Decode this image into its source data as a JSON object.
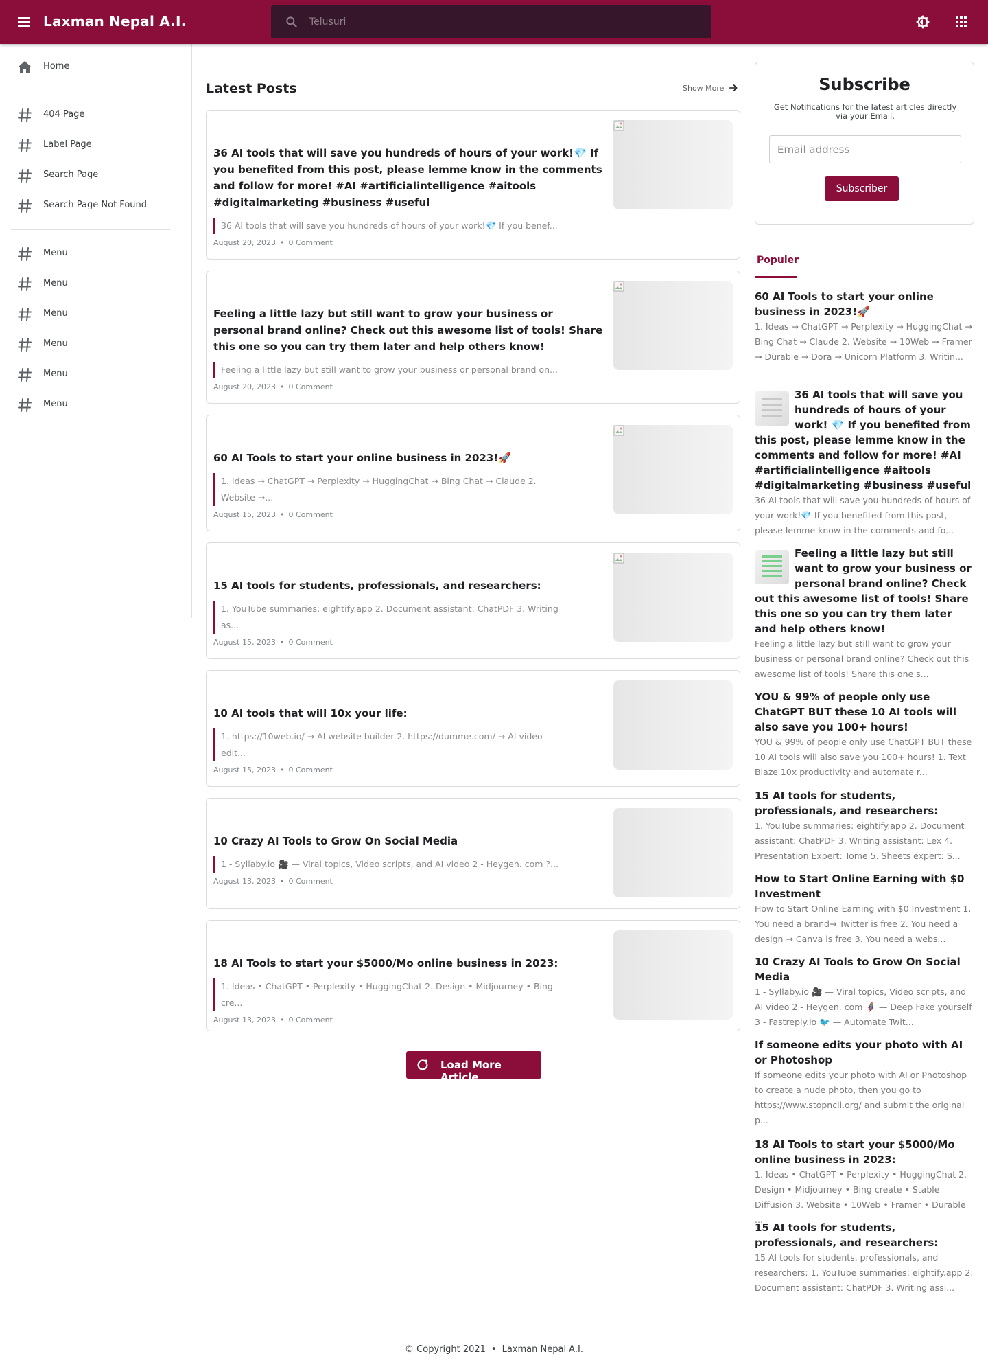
{
  "header": {
    "site_title": "Laxman Nepal A.I.",
    "search_placeholder": "Telusuri",
    "icons": [
      "menu-icon",
      "search-icon",
      "brightness-icon",
      "apps-grid-icon"
    ]
  },
  "sidebar": {
    "items": [
      {
        "label": "Home",
        "icon": "home-icon"
      },
      {
        "label": "404 Page",
        "icon": "hash-icon"
      },
      {
        "label": "Label Page",
        "icon": "hash-icon"
      },
      {
        "label": "Search Page",
        "icon": "hash-icon"
      },
      {
        "label": "Search Page Not Found",
        "icon": "hash-icon"
      },
      {
        "label": "Menu",
        "icon": "hash-icon"
      },
      {
        "label": "Menu",
        "icon": "hash-icon"
      },
      {
        "label": "Menu",
        "icon": "hash-icon"
      },
      {
        "label": "Menu",
        "icon": "hash-icon"
      },
      {
        "label": "Menu",
        "icon": "hash-icon"
      },
      {
        "label": "Menu",
        "icon": "hash-icon"
      }
    ]
  },
  "main": {
    "section_title": "Latest Posts",
    "show_more": "Show More",
    "posts": [
      {
        "title": "36 AI tools that will save you hundreds of hours of your work!💎 If you benefited from this post, please lemme know in the comments and follow for more! #AI #artificialintelligence #aitools #digitalmarketing #business #useful",
        "snippet": "36 AI tools that will save you hundreds of hours of your work!💎 If you benef...",
        "date": "August 20, 2023",
        "comments": "0 Comment"
      },
      {
        "title": "Feeling a little lazy but still want to grow your business or personal brand online? Check out this awesome list of tools! Share this one so you can try them later and help others know!",
        "snippet": "Feeling a little lazy but still want to grow your business or personal brand on...",
        "date": "August 20, 2023",
        "comments": "0 Comment"
      },
      {
        "title": "60 AI Tools to start your online business in 2023!🚀",
        "snippet": "1. Ideas → ChatGPT → Perplexity → HuggingChat → Bing Chat → Claude 2. Website →...",
        "date": "August 15, 2023",
        "comments": "0 Comment"
      },
      {
        "title": "15 AI tools for students, professionals, and researchers:",
        "snippet": "1. YouTube summaries: eightify.app 2. Document assistant: ChatPDF 3. Writing as...",
        "date": "August 15, 2023",
        "comments": "0 Comment"
      },
      {
        "title": "10 AI tools that will 10x your life:",
        "snippet": "1. https://10web.io/ → AI website builder 2. https://dumme.com/ → AI video edit...",
        "date": "August 15, 2023",
        "comments": "0 Comment"
      },
      {
        "title": "10 Crazy AI Tools to Grow On Social Media",
        "snippet": "1 - Syllaby.io 🎥 — Viral topics, Video scripts, and AI video 2 - Heygen. com ?...",
        "date": "August 13, 2023",
        "comments": "0 Comment"
      },
      {
        "title": "18 AI Tools to start your $5000/Mo online business in 2023:",
        "snippet": "1. Ideas • ChatGPT • Perplexity • HuggingChat 2. Design • Midjourney • Bing cre...",
        "date": "August 13, 2023",
        "comments": "0 Comment"
      }
    ],
    "load_more": "Load More Article"
  },
  "subscribe": {
    "title": "Subscribe",
    "description": "Get Notifications for the latest articles directly via your Email.",
    "email_placeholder": "Email address",
    "button": "Subscriber"
  },
  "popular": {
    "tab": "Populer",
    "items": [
      {
        "title": "60 AI Tools to start your online business in 2023!🚀",
        "snippet": "1. Ideas → ChatGPT → Perplexity → HuggingChat → Bing Chat → Claude 2. Website → 10Web → Framer → Durable → Dora → Unicorn Platform 3. Writin..."
      },
      {
        "title": "36 AI tools that will save you hundreds of hours of your work! 💎 If you benefited from this post, please lemme know in the comments and follow for more! #AI #artificialintelligence #aitools #digitalmarketing #business #useful",
        "snippet": " 36 AI tools that will save you hundreds of hours of your work!💎 If you benefited from this post, please lemme know in the comments and fo..."
      },
      {
        "title": "Feeling a little lazy but still want to grow your business or personal brand online? Check out this awesome list of tools! Share this one so you can try them later and help others know!",
        "snippet": "Feeling a little lazy but still want to grow your business or personal brand online? Check out this awesome list of tools!  Share this one s..."
      },
      {
        "title": "YOU & 99% of people only use ChatGPT BUT these 10 AI tools will also save you 100+ hours!",
        "snippet": " YOU & 99% of people only use ChatGPT BUT these 10 AI tools will also save you 100+ hours! 1. Text Blaze 10x productivity and automate r..."
      },
      {
        "title": "15 AI tools for students, professionals, and researchers:",
        "snippet": "1. YouTube summaries: eightify.app 2. Document assistant: ChatPDF 3. Writing assistant: Lex 4. Presentation Expert: Tome 5. Sheets expert: S..."
      },
      {
        "title": "How to Start Online Earning with $0 Investment",
        "snippet": " How to Start Online Earning with $0 Investment 1. You need a brand→ Twitter is free 2. You need a design → Canva is free 3. You need a webs..."
      },
      {
        "title": "10 Crazy AI Tools to Grow On Social Media",
        "snippet": "1 - Syllaby.io 🎥 — Viral topics, Video scripts, and AI video 2 - Heygen. com 🦸 — Deep Fake yourself 3 - Fastreply.io 🐦 — Automate Twit..."
      },
      {
        "title": "If someone edits your photo with AI or Photoshop",
        "snippet": " If someone edits your photo with AI or Photoshop to create a nude photo, then you go to https://www.stopncii.org/ and submit the original p..."
      },
      {
        "title": "18 AI Tools to start your $5000/Mo online business in 2023:",
        "snippet": "1. Ideas • ChatGPT • Perplexity • HuggingChat 2. Design • Midjourney • Bing create • Stable Diffusion 3. Website • 10Web • Framer • Durable ..."
      },
      {
        "title": "15 AI tools for students, professionals, and researchers:",
        "snippet": " 15 AI tools for students, professionals, and researchers: 1. YouTube summaries: eightify.app 2. Document assistant: ChatPDF 3. Writing assi..."
      }
    ]
  },
  "footer": {
    "copyright": "© Copyright 2021",
    "site": "Laxman Nepal A.I."
  },
  "colors": {
    "brand": "#8b0d3a",
    "search_bg": "#35162a"
  }
}
